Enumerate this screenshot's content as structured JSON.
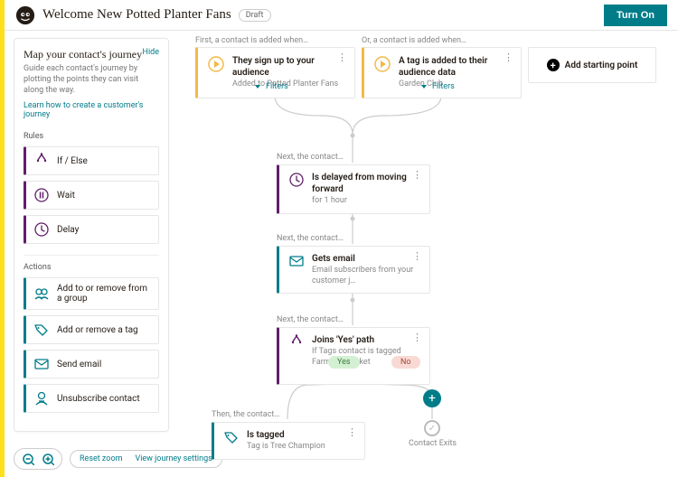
{
  "header": {
    "title": "Welcome New Potted Planter Fans",
    "draft_label": "Draft",
    "turn_on_label": "Turn On"
  },
  "sidebar": {
    "title": "Map your contact's journey",
    "hide": "Hide",
    "subtitle": "Guide each contact's journey by plotting the points they can visit along the way.",
    "learn": "Learn how to create a customer's journey",
    "rules_label": "Rules",
    "actions_label": "Actions",
    "rules": [
      {
        "icon": "split-icon",
        "label": "If / Else"
      },
      {
        "icon": "pause-icon",
        "label": "Wait"
      },
      {
        "icon": "clock-icon",
        "label": "Delay"
      }
    ],
    "actions": [
      {
        "icon": "group-icon",
        "label": "Add to or remove from a group"
      },
      {
        "icon": "tag-icon",
        "label": "Add or remove a tag"
      },
      {
        "icon": "mail-icon",
        "label": "Send email"
      },
      {
        "icon": "unsub-icon",
        "label": "Unsubscribe contact"
      }
    ]
  },
  "zoom": {
    "reset": "Reset zoom",
    "view": "View journey settings"
  },
  "canvas": {
    "hint_first": "First, a contact is added when…",
    "hint_or": "Or, a contact is added when…",
    "hint_next": "Next, the contact…",
    "hint_then": "Then, the contact…",
    "filters_label": "Filters",
    "add_start": "Add starting point",
    "start_nodes": [
      {
        "title": "They sign up to your audience",
        "sub": "Added to Potted Planter Fans"
      },
      {
        "title": "A tag is added to their audience data",
        "sub": "Garden Club"
      }
    ],
    "nodes": {
      "delay": {
        "title": "Is delayed from moving forward",
        "sub": "for 1 hour"
      },
      "email": {
        "title": "Gets email",
        "sub": "Email subscribers from your customer j…"
      },
      "split": {
        "title": "Joins 'Yes' path",
        "sub": "If Tags contact is tagged Farmer's Market"
      },
      "tagged": {
        "title": "Is tagged",
        "sub": "Tag is Tree Champion"
      }
    },
    "yes": "Yes",
    "no": "No",
    "exit": "Contact Exits"
  }
}
